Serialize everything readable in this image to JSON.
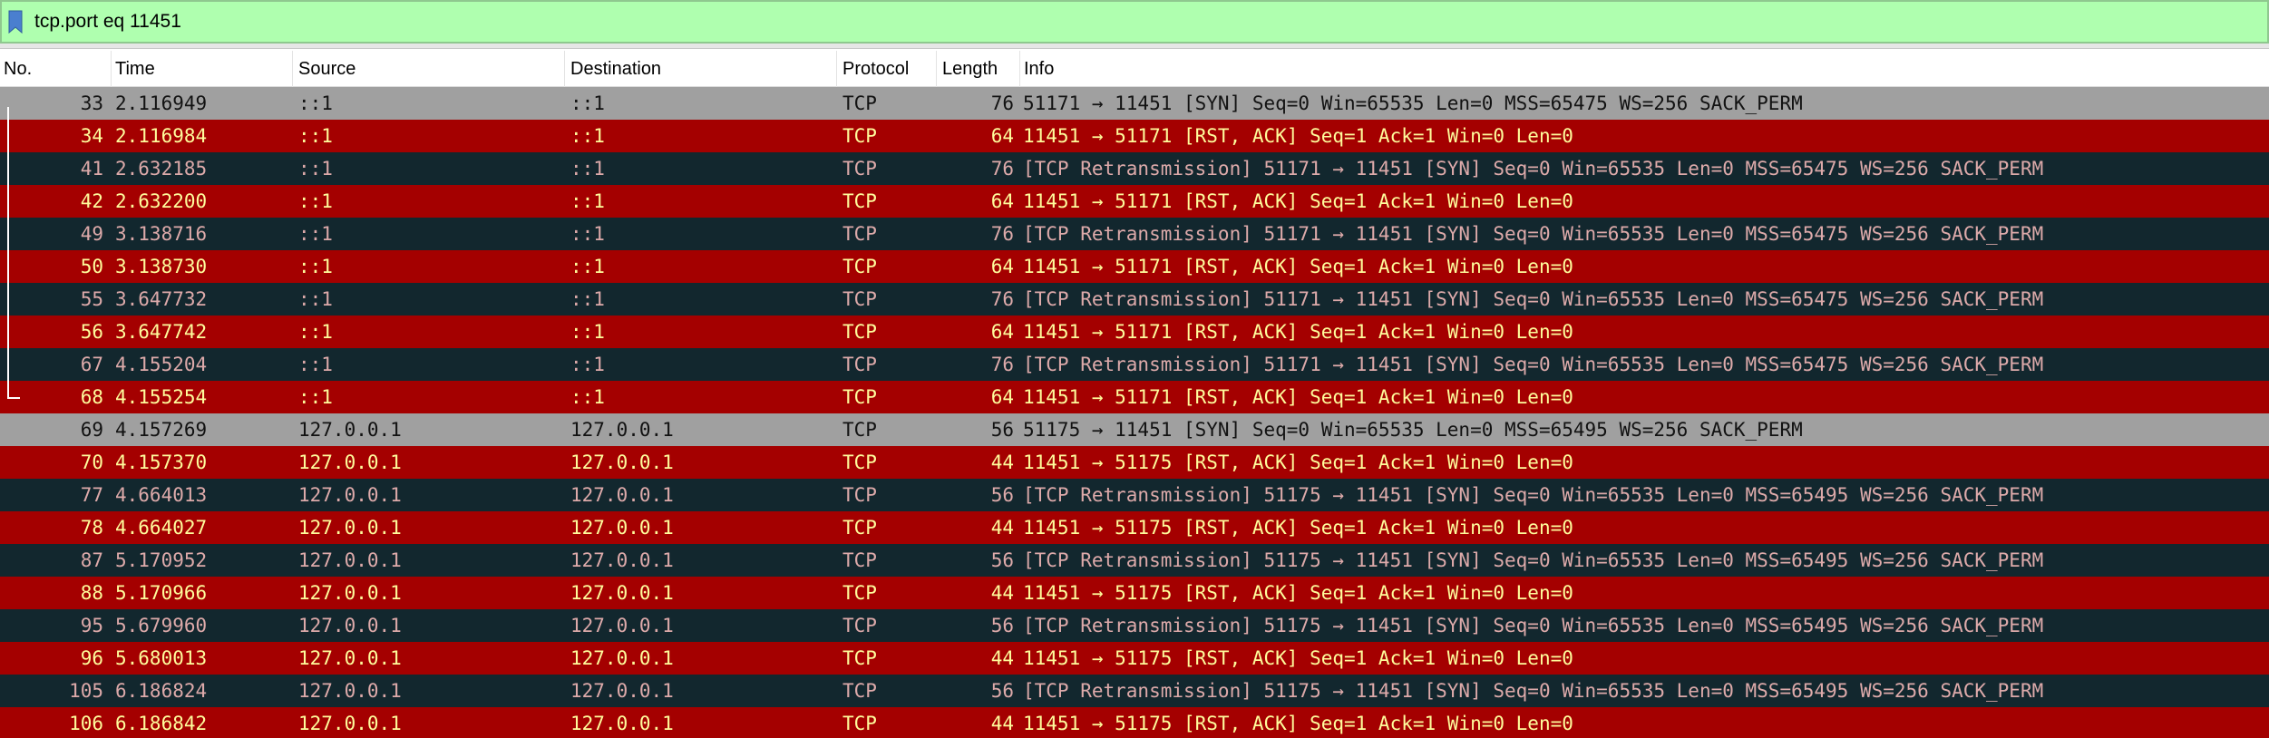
{
  "filter": {
    "value": "tcp.port eq 11451",
    "bookmark_icon": "bookmark-icon",
    "background": "#afffaf"
  },
  "columns": {
    "no": "No.",
    "time": "Time",
    "source": "Source",
    "destination": "Destination",
    "protocol": "Protocol",
    "length": "Length",
    "info": "Info"
  },
  "colors": {
    "gray_row_bg": "#a0a0a0",
    "dark_row_bg": "#12272e",
    "dark_row_fg": "#ddaaaa",
    "red_row_bg": "#a40000",
    "red_row_fg": "#fffc9c"
  },
  "packets": [
    {
      "no": "33",
      "time": "2.116949",
      "source": "::1",
      "destination": "::1",
      "protocol": "TCP",
      "length": "76",
      "info": "51171 → 11451 [SYN] Seq=0 Win=65535 Len=0 MSS=65475 WS=256 SACK_PERM",
      "style": "gray"
    },
    {
      "no": "34",
      "time": "2.116984",
      "source": "::1",
      "destination": "::1",
      "protocol": "TCP",
      "length": "64",
      "info": "11451 → 51171 [RST, ACK] Seq=1 Ack=1 Win=0 Len=0",
      "style": "red"
    },
    {
      "no": "41",
      "time": "2.632185",
      "source": "::1",
      "destination": "::1",
      "protocol": "TCP",
      "length": "76",
      "info": "[TCP Retransmission] 51171 → 11451 [SYN] Seq=0 Win=65535 Len=0 MSS=65475 WS=256 SACK_PERM",
      "style": "dark"
    },
    {
      "no": "42",
      "time": "2.632200",
      "source": "::1",
      "destination": "::1",
      "protocol": "TCP",
      "length": "64",
      "info": "11451 → 51171 [RST, ACK] Seq=1 Ack=1 Win=0 Len=0",
      "style": "red"
    },
    {
      "no": "49",
      "time": "3.138716",
      "source": "::1",
      "destination": "::1",
      "protocol": "TCP",
      "length": "76",
      "info": "[TCP Retransmission] 51171 → 11451 [SYN] Seq=0 Win=65535 Len=0 MSS=65475 WS=256 SACK_PERM",
      "style": "dark"
    },
    {
      "no": "50",
      "time": "3.138730",
      "source": "::1",
      "destination": "::1",
      "protocol": "TCP",
      "length": "64",
      "info": "11451 → 51171 [RST, ACK] Seq=1 Ack=1 Win=0 Len=0",
      "style": "red"
    },
    {
      "no": "55",
      "time": "3.647732",
      "source": "::1",
      "destination": "::1",
      "protocol": "TCP",
      "length": "76",
      "info": "[TCP Retransmission] 51171 → 11451 [SYN] Seq=0 Win=65535 Len=0 MSS=65475 WS=256 SACK_PERM",
      "style": "dark"
    },
    {
      "no": "56",
      "time": "3.647742",
      "source": "::1",
      "destination": "::1",
      "protocol": "TCP",
      "length": "64",
      "info": "11451 → 51171 [RST, ACK] Seq=1 Ack=1 Win=0 Len=0",
      "style": "red"
    },
    {
      "no": "67",
      "time": "4.155204",
      "source": "::1",
      "destination": "::1",
      "protocol": "TCP",
      "length": "76",
      "info": "[TCP Retransmission] 51171 → 11451 [SYN] Seq=0 Win=65535 Len=0 MSS=65475 WS=256 SACK_PERM",
      "style": "dark"
    },
    {
      "no": "68",
      "time": "4.155254",
      "source": "::1",
      "destination": "::1",
      "protocol": "TCP",
      "length": "64",
      "info": "11451 → 51171 [RST, ACK] Seq=1 Ack=1 Win=0 Len=0",
      "style": "red"
    },
    {
      "no": "69",
      "time": "4.157269",
      "source": "127.0.0.1",
      "destination": "127.0.0.1",
      "protocol": "TCP",
      "length": "56",
      "info": "51175 → 11451 [SYN] Seq=0 Win=65535 Len=0 MSS=65495 WS=256 SACK_PERM",
      "style": "gray"
    },
    {
      "no": "70",
      "time": "4.157370",
      "source": "127.0.0.1",
      "destination": "127.0.0.1",
      "protocol": "TCP",
      "length": "44",
      "info": "11451 → 51175 [RST, ACK] Seq=1 Ack=1 Win=0 Len=0",
      "style": "red"
    },
    {
      "no": "77",
      "time": "4.664013",
      "source": "127.0.0.1",
      "destination": "127.0.0.1",
      "protocol": "TCP",
      "length": "56",
      "info": "[TCP Retransmission] 51175 → 11451 [SYN] Seq=0 Win=65535 Len=0 MSS=65495 WS=256 SACK_PERM",
      "style": "dark"
    },
    {
      "no": "78",
      "time": "4.664027",
      "source": "127.0.0.1",
      "destination": "127.0.0.1",
      "protocol": "TCP",
      "length": "44",
      "info": "11451 → 51175 [RST, ACK] Seq=1 Ack=1 Win=0 Len=0",
      "style": "red"
    },
    {
      "no": "87",
      "time": "5.170952",
      "source": "127.0.0.1",
      "destination": "127.0.0.1",
      "protocol": "TCP",
      "length": "56",
      "info": "[TCP Retransmission] 51175 → 11451 [SYN] Seq=0 Win=65535 Len=0 MSS=65495 WS=256 SACK_PERM",
      "style": "dark"
    },
    {
      "no": "88",
      "time": "5.170966",
      "source": "127.0.0.1",
      "destination": "127.0.0.1",
      "protocol": "TCP",
      "length": "44",
      "info": "11451 → 51175 [RST, ACK] Seq=1 Ack=1 Win=0 Len=0",
      "style": "red"
    },
    {
      "no": "95",
      "time": "5.679960",
      "source": "127.0.0.1",
      "destination": "127.0.0.1",
      "protocol": "TCP",
      "length": "56",
      "info": "[TCP Retransmission] 51175 → 11451 [SYN] Seq=0 Win=65535 Len=0 MSS=65495 WS=256 SACK_PERM",
      "style": "dark"
    },
    {
      "no": "96",
      "time": "5.680013",
      "source": "127.0.0.1",
      "destination": "127.0.0.1",
      "protocol": "TCP",
      "length": "44",
      "info": "11451 → 51175 [RST, ACK] Seq=1 Ack=1 Win=0 Len=0",
      "style": "red"
    },
    {
      "no": "105",
      "time": "6.186824",
      "source": "127.0.0.1",
      "destination": "127.0.0.1",
      "protocol": "TCP",
      "length": "56",
      "info": "[TCP Retransmission] 51175 → 11451 [SYN] Seq=0 Win=65535 Len=0 MSS=65495 WS=256 SACK_PERM",
      "style": "dark"
    },
    {
      "no": "106",
      "time": "6.186842",
      "source": "127.0.0.1",
      "destination": "127.0.0.1",
      "protocol": "TCP",
      "length": "44",
      "info": "11451 → 51175 [RST, ACK] Seq=1 Ack=1 Win=0 Len=0",
      "style": "red"
    }
  ]
}
